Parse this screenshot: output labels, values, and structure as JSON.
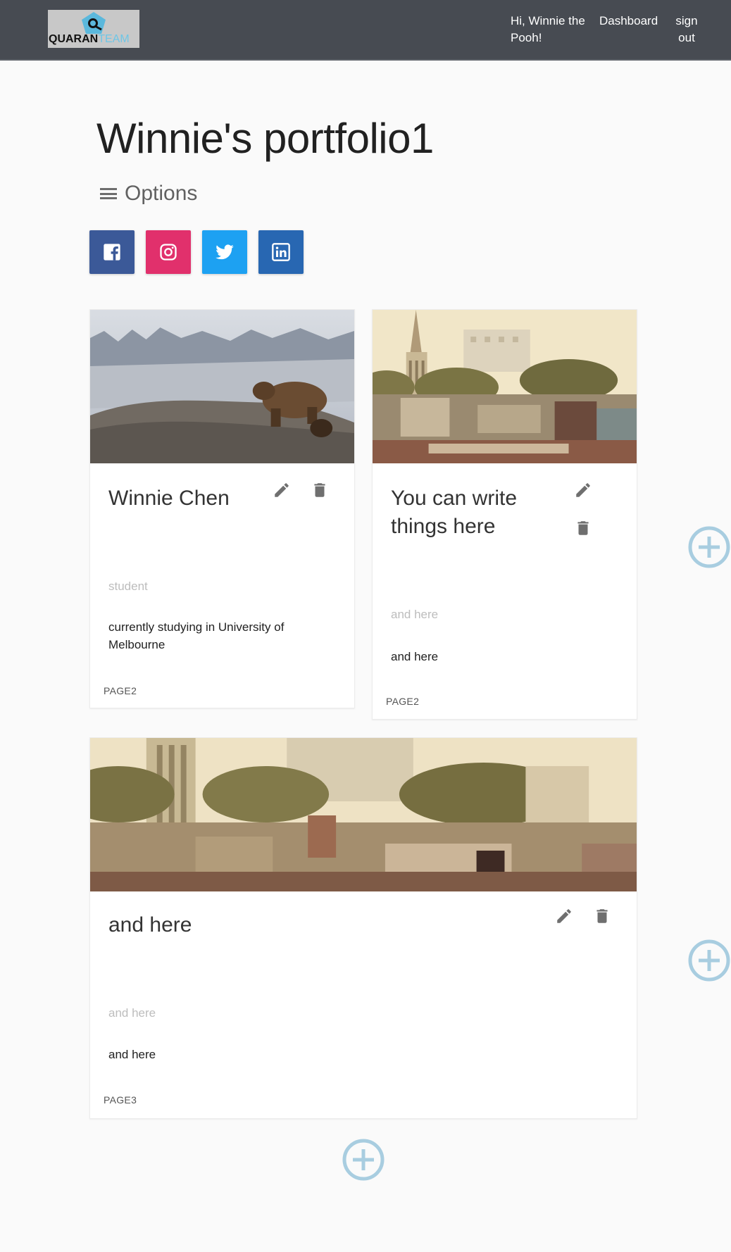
{
  "nav": {
    "logo_text_dark": "QUARAN",
    "logo_text_light": "TEAM",
    "greeting": "Hi, Winnie the Pooh!",
    "dashboard": "Dashboard",
    "signout": "sign out"
  },
  "page": {
    "title": "Winnie's portfolio1",
    "options_label": "Options"
  },
  "social": [
    {
      "name": "facebook",
      "icon": "facebook-icon",
      "color": "#3b5998"
    },
    {
      "name": "instagram",
      "icon": "instagram-icon",
      "color": "#e1306c"
    },
    {
      "name": "twitter",
      "icon": "twitter-icon",
      "color": "#1da1f2"
    },
    {
      "name": "linkedin",
      "icon": "linkedin-icon",
      "color": "#2867b2"
    }
  ],
  "cards": [
    {
      "title": "Winnie Chen",
      "subtitle": "student",
      "description": "currently studying in University of Melbourne",
      "page": "PAGE2"
    },
    {
      "title": "You can write things here",
      "subtitle": "and here",
      "description": "and here",
      "page": "PAGE2"
    },
    {
      "title": "and here",
      "subtitle": "and here",
      "description": "and here",
      "page": "PAGE3"
    }
  ],
  "colors": {
    "navbar": "#474b52",
    "add_button": "#a8cde0",
    "icon_gray": "#6f6f6f"
  }
}
